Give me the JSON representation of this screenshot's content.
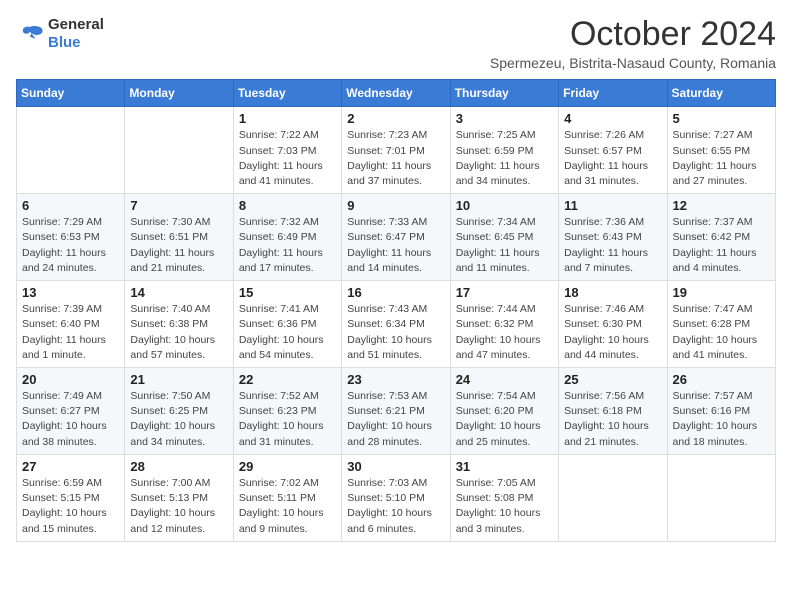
{
  "logo": {
    "general": "General",
    "blue": "Blue"
  },
  "title": "October 2024",
  "subtitle": "Spermezeu, Bistrita-Nasaud County, Romania",
  "days_of_week": [
    "Sunday",
    "Monday",
    "Tuesday",
    "Wednesday",
    "Thursday",
    "Friday",
    "Saturday"
  ],
  "weeks": [
    [
      {
        "day": "",
        "info": ""
      },
      {
        "day": "",
        "info": ""
      },
      {
        "day": "1",
        "info": "Sunrise: 7:22 AM\nSunset: 7:03 PM\nDaylight: 11 hours and 41 minutes."
      },
      {
        "day": "2",
        "info": "Sunrise: 7:23 AM\nSunset: 7:01 PM\nDaylight: 11 hours and 37 minutes."
      },
      {
        "day": "3",
        "info": "Sunrise: 7:25 AM\nSunset: 6:59 PM\nDaylight: 11 hours and 34 minutes."
      },
      {
        "day": "4",
        "info": "Sunrise: 7:26 AM\nSunset: 6:57 PM\nDaylight: 11 hours and 31 minutes."
      },
      {
        "day": "5",
        "info": "Sunrise: 7:27 AM\nSunset: 6:55 PM\nDaylight: 11 hours and 27 minutes."
      }
    ],
    [
      {
        "day": "6",
        "info": "Sunrise: 7:29 AM\nSunset: 6:53 PM\nDaylight: 11 hours and 24 minutes."
      },
      {
        "day": "7",
        "info": "Sunrise: 7:30 AM\nSunset: 6:51 PM\nDaylight: 11 hours and 21 minutes."
      },
      {
        "day": "8",
        "info": "Sunrise: 7:32 AM\nSunset: 6:49 PM\nDaylight: 11 hours and 17 minutes."
      },
      {
        "day": "9",
        "info": "Sunrise: 7:33 AM\nSunset: 6:47 PM\nDaylight: 11 hours and 14 minutes."
      },
      {
        "day": "10",
        "info": "Sunrise: 7:34 AM\nSunset: 6:45 PM\nDaylight: 11 hours and 11 minutes."
      },
      {
        "day": "11",
        "info": "Sunrise: 7:36 AM\nSunset: 6:43 PM\nDaylight: 11 hours and 7 minutes."
      },
      {
        "day": "12",
        "info": "Sunrise: 7:37 AM\nSunset: 6:42 PM\nDaylight: 11 hours and 4 minutes."
      }
    ],
    [
      {
        "day": "13",
        "info": "Sunrise: 7:39 AM\nSunset: 6:40 PM\nDaylight: 11 hours and 1 minute."
      },
      {
        "day": "14",
        "info": "Sunrise: 7:40 AM\nSunset: 6:38 PM\nDaylight: 10 hours and 57 minutes."
      },
      {
        "day": "15",
        "info": "Sunrise: 7:41 AM\nSunset: 6:36 PM\nDaylight: 10 hours and 54 minutes."
      },
      {
        "day": "16",
        "info": "Sunrise: 7:43 AM\nSunset: 6:34 PM\nDaylight: 10 hours and 51 minutes."
      },
      {
        "day": "17",
        "info": "Sunrise: 7:44 AM\nSunset: 6:32 PM\nDaylight: 10 hours and 47 minutes."
      },
      {
        "day": "18",
        "info": "Sunrise: 7:46 AM\nSunset: 6:30 PM\nDaylight: 10 hours and 44 minutes."
      },
      {
        "day": "19",
        "info": "Sunrise: 7:47 AM\nSunset: 6:28 PM\nDaylight: 10 hours and 41 minutes."
      }
    ],
    [
      {
        "day": "20",
        "info": "Sunrise: 7:49 AM\nSunset: 6:27 PM\nDaylight: 10 hours and 38 minutes."
      },
      {
        "day": "21",
        "info": "Sunrise: 7:50 AM\nSunset: 6:25 PM\nDaylight: 10 hours and 34 minutes."
      },
      {
        "day": "22",
        "info": "Sunrise: 7:52 AM\nSunset: 6:23 PM\nDaylight: 10 hours and 31 minutes."
      },
      {
        "day": "23",
        "info": "Sunrise: 7:53 AM\nSunset: 6:21 PM\nDaylight: 10 hours and 28 minutes."
      },
      {
        "day": "24",
        "info": "Sunrise: 7:54 AM\nSunset: 6:20 PM\nDaylight: 10 hours and 25 minutes."
      },
      {
        "day": "25",
        "info": "Sunrise: 7:56 AM\nSunset: 6:18 PM\nDaylight: 10 hours and 21 minutes."
      },
      {
        "day": "26",
        "info": "Sunrise: 7:57 AM\nSunset: 6:16 PM\nDaylight: 10 hours and 18 minutes."
      }
    ],
    [
      {
        "day": "27",
        "info": "Sunrise: 6:59 AM\nSunset: 5:15 PM\nDaylight: 10 hours and 15 minutes."
      },
      {
        "day": "28",
        "info": "Sunrise: 7:00 AM\nSunset: 5:13 PM\nDaylight: 10 hours and 12 minutes."
      },
      {
        "day": "29",
        "info": "Sunrise: 7:02 AM\nSunset: 5:11 PM\nDaylight: 10 hours and 9 minutes."
      },
      {
        "day": "30",
        "info": "Sunrise: 7:03 AM\nSunset: 5:10 PM\nDaylight: 10 hours and 6 minutes."
      },
      {
        "day": "31",
        "info": "Sunrise: 7:05 AM\nSunset: 5:08 PM\nDaylight: 10 hours and 3 minutes."
      },
      {
        "day": "",
        "info": ""
      },
      {
        "day": "",
        "info": ""
      }
    ]
  ]
}
